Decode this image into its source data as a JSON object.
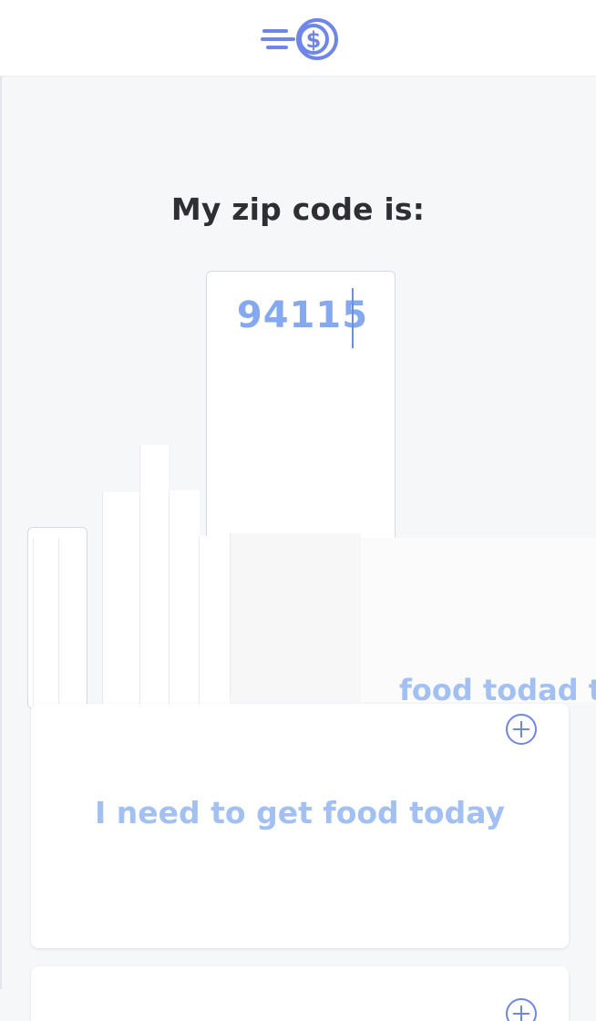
{
  "header": {
    "logo_icon": "menu-coin-logo-icon",
    "accent_color": "#6f86e8"
  },
  "zip_prompt": {
    "title": "My zip code is:",
    "value": "94115"
  },
  "ghost_artifact": {
    "text": "food todad to"
  },
  "options": [
    {
      "label": "I need to get food today",
      "action_icon": "plus-circle-icon"
    },
    {
      "label": "",
      "action_icon": "plus-circle-icon"
    }
  ],
  "colors": {
    "background": "#f6f7f9",
    "title_text": "#2f2f33",
    "zip_text": "#84a9ef",
    "option_text": "#a3c0f3"
  }
}
